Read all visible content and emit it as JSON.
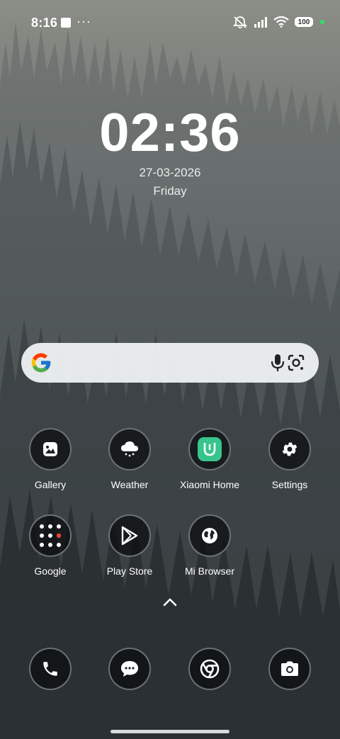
{
  "status_bar": {
    "time": "8:16",
    "menu_dots": "···",
    "battery": "100"
  },
  "lock_clock": {
    "time": "02:36",
    "date": "27-03-2026",
    "day": "Friday"
  },
  "search_bar": {
    "google_icon": "google-g-icon",
    "mic_icon": "mic-icon",
    "lens_icon": "lens-icon"
  },
  "apps_row1": [
    {
      "label": "Gallery",
      "icon": "gallery-icon"
    },
    {
      "label": "Weather",
      "icon": "weather-icon"
    },
    {
      "label": "Xiaomi Home",
      "icon": "xiaomi-home-icon"
    },
    {
      "label": "Settings",
      "icon": "gear-icon"
    }
  ],
  "apps_row2": [
    {
      "label": "Google",
      "icon": "google-folder-icon"
    },
    {
      "label": "Play Store",
      "icon": "play-store-icon"
    },
    {
      "label": "Mi Browser",
      "icon": "globe-icon"
    }
  ],
  "dock": [
    {
      "icon": "phone-icon"
    },
    {
      "icon": "messages-icon"
    },
    {
      "icon": "chrome-icon"
    },
    {
      "icon": "camera-icon"
    }
  ],
  "colors": {
    "xiaomi_home_green": "#37c58c",
    "play_green": "#2ee06b"
  }
}
